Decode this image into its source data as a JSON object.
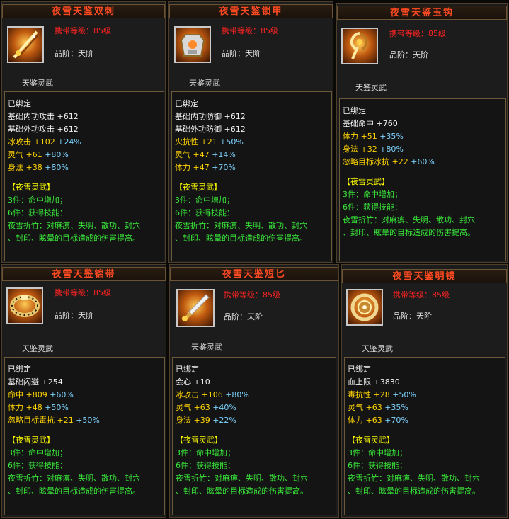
{
  "cards": [
    {
      "title": "夜雪天鉴双刺",
      "required_level": "携带等级：85级",
      "grade": "品阶：天阶",
      "subtitle": "天鉴灵武",
      "bound": "已绑定",
      "base_stats": [
        {
          "name": "基础内功攻击",
          "value": "+612"
        },
        {
          "name": "基础外功攻击",
          "value": "+612"
        }
      ],
      "extra_stats": [
        {
          "name": "冰攻击",
          "value": "+102",
          "bonus": "+24%"
        },
        {
          "name": "灵气",
          "value": "+61",
          "bonus": "+80%"
        },
        {
          "name": "身法",
          "value": "+38",
          "bonus": "+80%"
        }
      ],
      "set_name": "【夜雪灵武】",
      "set_bonuses": [
        "3件：命中增加；",
        "6件：获得技能：",
        "夜雪折竹：对麻痹、失明、散功、封穴",
        "、封印、眩晕的目标造成的伤害提高。"
      ],
      "icon": "twin-daggers-icon"
    },
    {
      "title": "夜雪天鉴锁甲",
      "required_level": "携带等级：85级",
      "grade": "品阶：天阶",
      "subtitle": "天鉴灵武",
      "bound": "已绑定",
      "base_stats": [
        {
          "name": "基础内功防御",
          "value": "+612"
        },
        {
          "name": "基础外功防御",
          "value": "+612"
        }
      ],
      "extra_stats": [
        {
          "name": "火抗性",
          "value": "+21",
          "bonus": "+50%"
        },
        {
          "name": "灵气",
          "value": "+47",
          "bonus": "+14%"
        },
        {
          "name": "体力",
          "value": "+47",
          "bonus": "+70%"
        }
      ],
      "set_name": "【夜雪灵武】",
      "set_bonuses": [
        "3件：命中增加；",
        "6件：获得技能：",
        "夜雪折竹：对麻痹、失明、散功、封穴",
        "、封印、眩晕的目标造成的伤害提高。"
      ],
      "icon": "armor-icon"
    },
    {
      "title": "夜雪天鉴玉钩",
      "required_level": "携带等级：85级",
      "grade": "品阶：天阶",
      "subtitle": "天鉴灵武",
      "bound": "已绑定",
      "base_stats": [
        {
          "name": "基础命中",
          "value": "+760"
        }
      ],
      "extra_stats": [
        {
          "name": "体力",
          "value": "+51",
          "bonus": "+35%"
        },
        {
          "name": "身法",
          "value": "+32",
          "bonus": "+80%"
        },
        {
          "name": "忽略目标冰抗",
          "value": "+22",
          "bonus": "+60%"
        }
      ],
      "set_name": "【夜雪灵武】",
      "set_bonuses": [
        "3件：命中增加；",
        "6件：获得技能：",
        "夜雪折竹：对麻痹、失明、散功、封穴",
        "、封印、眩晕的目标造成的伤害提高。"
      ],
      "icon": "jade-hook-icon"
    },
    {
      "title": "夜雪天鉴锦带",
      "required_level": "携带等级：85级",
      "grade": "品阶：天阶",
      "subtitle": "天鉴灵武",
      "bound": "已绑定",
      "base_stats": [
        {
          "name": "基础闪避",
          "value": "+254"
        }
      ],
      "extra_stats": [
        {
          "name": "命中",
          "value": "+809",
          "bonus": "+60%"
        },
        {
          "name": "体力",
          "value": "+48",
          "bonus": "+50%"
        },
        {
          "name": "忽略目标毒抗",
          "value": "+21",
          "bonus": "+50%"
        }
      ],
      "set_name": "【夜雪灵武】",
      "set_bonuses": [
        "3件：命中增加；",
        "6件：获得技能：",
        "夜雪折竹：对麻痹、失明、散功、封穴",
        "、封印、眩晕的目标造成的伤害提高。"
      ],
      "icon": "belt-icon"
    },
    {
      "title": "夜雪天鉴短匕",
      "required_level": "携带等级：85级",
      "grade": "品阶：天阶",
      "subtitle": "天鉴灵武",
      "bound": "已绑定",
      "base_stats": [
        {
          "name": "会心",
          "value": "+10"
        }
      ],
      "extra_stats": [
        {
          "name": "冰攻击",
          "value": "+106",
          "bonus": "+80%"
        },
        {
          "name": "灵气",
          "value": "+63",
          "bonus": "+40%"
        },
        {
          "name": "身法",
          "value": "+39",
          "bonus": "+22%"
        }
      ],
      "set_name": "【夜雪灵武】",
      "set_bonuses": [
        "3件：命中增加；",
        "6件：获得技能：",
        "夜雪折竹：对麻痹、失明、散功、封穴",
        "、封印、眩晕的目标造成的伤害提高。"
      ],
      "icon": "dagger-icon"
    },
    {
      "title": "夜雪天鉴明镜",
      "required_level": "携带等级：85级",
      "grade": "品阶：天阶",
      "subtitle": "天鉴灵武",
      "bound": "已绑定",
      "base_stats": [
        {
          "name": "血上限",
          "value": "+3830"
        }
      ],
      "extra_stats": [
        {
          "name": "毒抗性",
          "value": "+28",
          "bonus": "+50%"
        },
        {
          "name": "灵气",
          "value": "+63",
          "bonus": "+35%"
        },
        {
          "name": "体力",
          "value": "+63",
          "bonus": "+70%"
        }
      ],
      "set_name": "【夜雪灵武】",
      "set_bonuses": [
        "3件：命中增加；",
        "6件：获得技能：",
        "夜雪折竹：对麻痹、失明、散功、封穴",
        "、封印、眩晕的目标造成的伤害提高。"
      ],
      "icon": "mirror-icon"
    }
  ]
}
